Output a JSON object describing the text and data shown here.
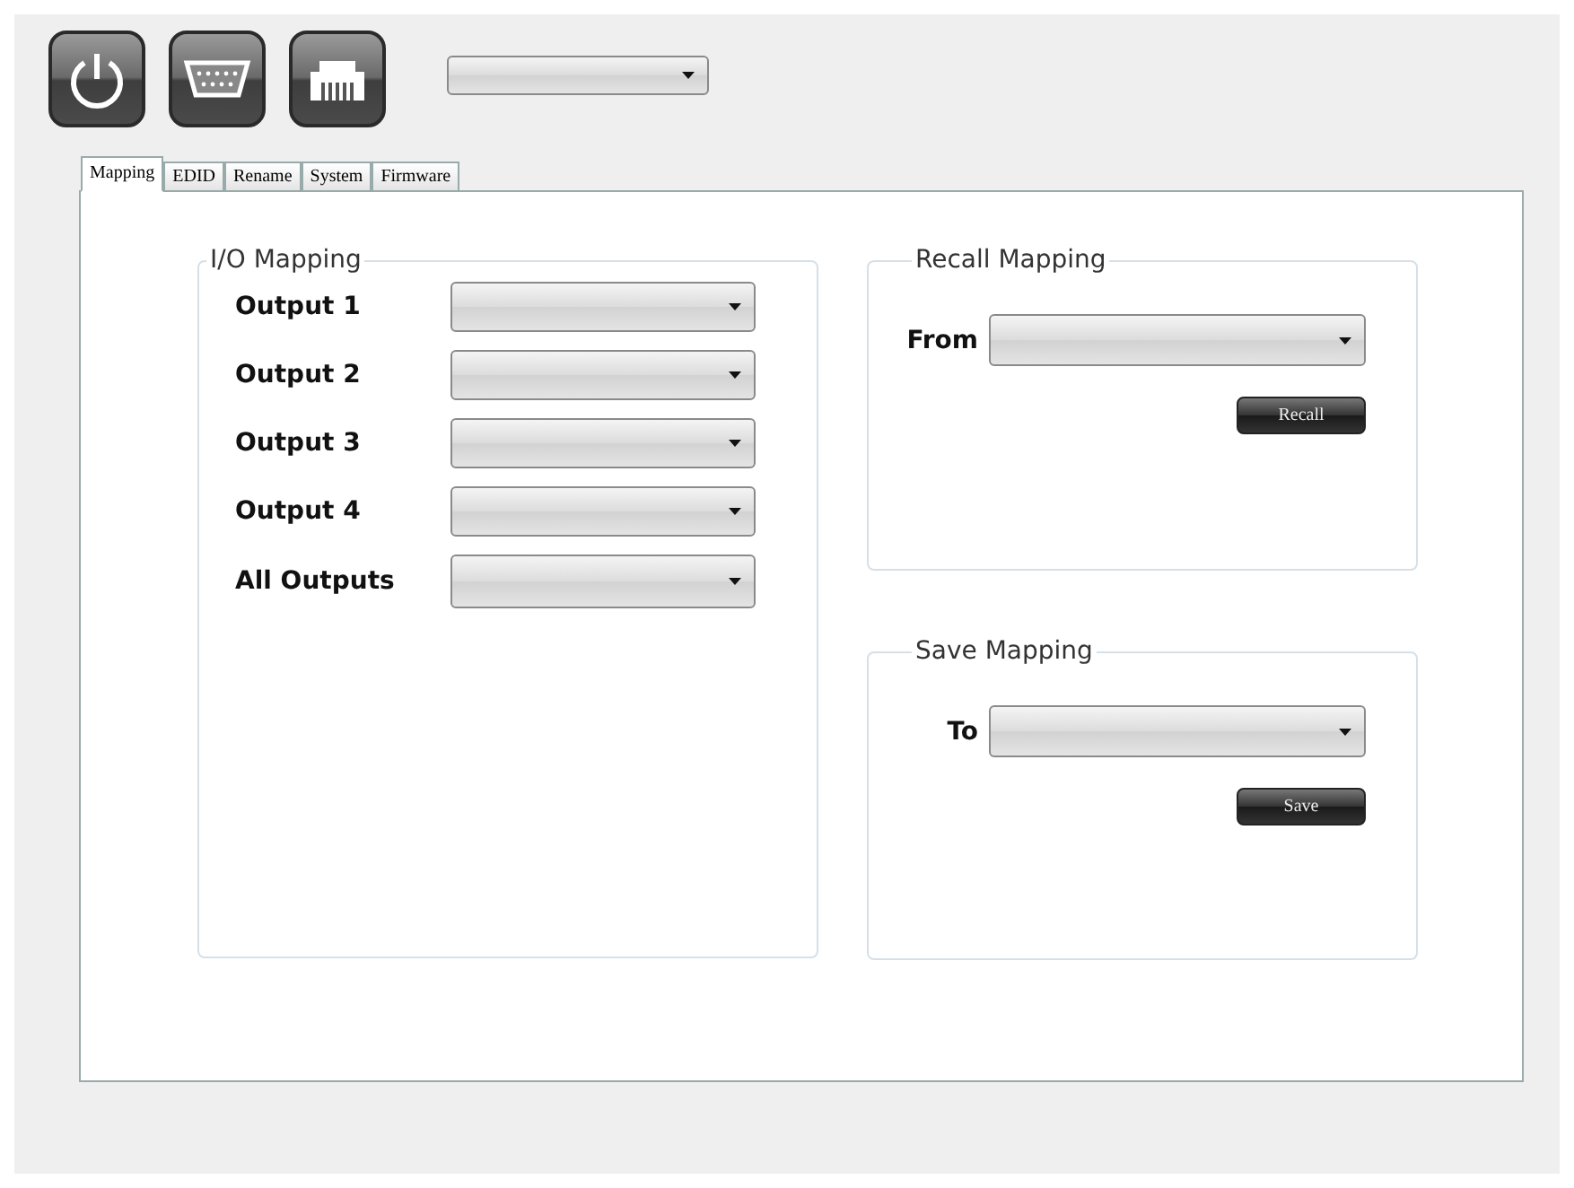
{
  "toolbar": {
    "buttons": [
      {
        "kind": "power"
      },
      {
        "kind": "serial"
      },
      {
        "kind": "network"
      }
    ]
  },
  "tabs": [
    {
      "label": "Mapping",
      "selected": true
    },
    {
      "label": "EDID",
      "selected": false
    },
    {
      "label": "Rename",
      "selected": false
    },
    {
      "label": "System",
      "selected": false
    },
    {
      "label": "Firmware",
      "selected": false
    }
  ],
  "io_mapping": {
    "title": "I/O Mapping",
    "rows": [
      {
        "label": "Output 1"
      },
      {
        "label": "Output 2"
      },
      {
        "label": "Output 3"
      },
      {
        "label": "Output 4"
      },
      {
        "label": "All Outputs"
      }
    ]
  },
  "recall_mapping": {
    "title": "Recall Mapping",
    "label": "From",
    "button": "Recall"
  },
  "save_mapping": {
    "title": "Save Mapping",
    "label": "To",
    "button": "Save"
  }
}
